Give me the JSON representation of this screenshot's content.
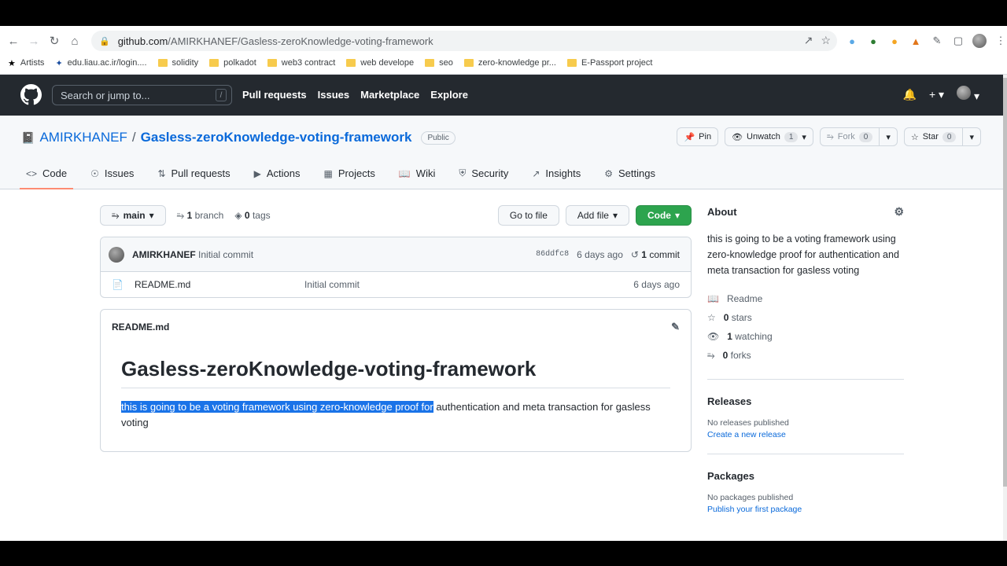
{
  "browser": {
    "url_host": "github.com",
    "url_path": "/AMIRKHANEF/Gasless-zeroKnowledge-voting-framework",
    "bookmarks": [
      "Artists",
      "edu.liau.ac.ir/login....",
      "solidity",
      "polkadot",
      "web3 contract",
      "web develope",
      "seo",
      "zero-knowledge pr...",
      "E-Passport project"
    ]
  },
  "github": {
    "search_placeholder": "Search or jump to...",
    "search_key": "/",
    "nav": [
      "Pull requests",
      "Issues",
      "Marketplace",
      "Explore"
    ]
  },
  "repo": {
    "owner": "AMIRKHANEF",
    "name": "Gasless-zeroKnowledge-voting-framework",
    "visibility": "Public",
    "pin": "Pin",
    "unwatch": "Unwatch",
    "watch_count": "1",
    "fork": "Fork",
    "fork_count": "0",
    "star": "Star",
    "star_count": "0",
    "tabs": [
      "Code",
      "Issues",
      "Pull requests",
      "Actions",
      "Projects",
      "Wiki",
      "Security",
      "Insights",
      "Settings"
    ]
  },
  "filebar": {
    "branch": "main",
    "branch_count": "1",
    "branch_label": "branch",
    "tag_count": "0",
    "tag_label": "tags",
    "goto": "Go to file",
    "add": "Add file",
    "code": "Code"
  },
  "commit": {
    "author": "AMIRKHANEF",
    "message": "Initial commit",
    "sha": "86ddfc8",
    "age": "6 days ago",
    "count": "1",
    "count_label": "commit"
  },
  "files": [
    {
      "name": "README.md",
      "message": "Initial commit",
      "age": "6 days ago"
    }
  ],
  "readme": {
    "file": "README.md",
    "heading": "Gasless-zeroKnowledge-voting-framework",
    "text_selected": "this is going to be a voting framework using zero-knowledge proof for",
    "text_rest": " authentication and meta transaction for gasless voting"
  },
  "about": {
    "title": "About",
    "description": "this is going to be a voting framework using zero-knowledge proof for authentication and meta transaction for gasless voting",
    "readme": "Readme",
    "stars_count": "0",
    "stars_label": "stars",
    "watching_count": "1",
    "watching_label": "watching",
    "forks_count": "0",
    "forks_label": "forks"
  },
  "releases": {
    "title": "Releases",
    "none": "No releases published",
    "link": "Create a new release"
  },
  "packages": {
    "title": "Packages",
    "none": "No packages published",
    "link": "Publish your first package"
  },
  "colors": {
    "green": "#2da44e",
    "link": "#0969da",
    "header": "#24292f",
    "selection": "#1a73e8",
    "tab_underline": "#fd8c73"
  }
}
